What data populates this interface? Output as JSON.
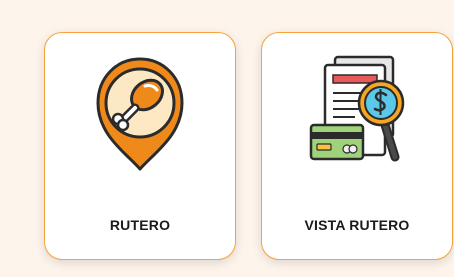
{
  "cards": [
    {
      "label": "RUTERO",
      "icon": "chicken-leg-pin-icon"
    },
    {
      "label": "VISTA RUTERO",
      "icon": "receipt-magnifier-icon"
    }
  ],
  "colors": {
    "page_background": "#fdf4ec",
    "card_border": "#f7a23a",
    "pin_orange": "#ef8a1a",
    "pin_cream": "#fde8c4",
    "text": "#1b1b1b"
  }
}
